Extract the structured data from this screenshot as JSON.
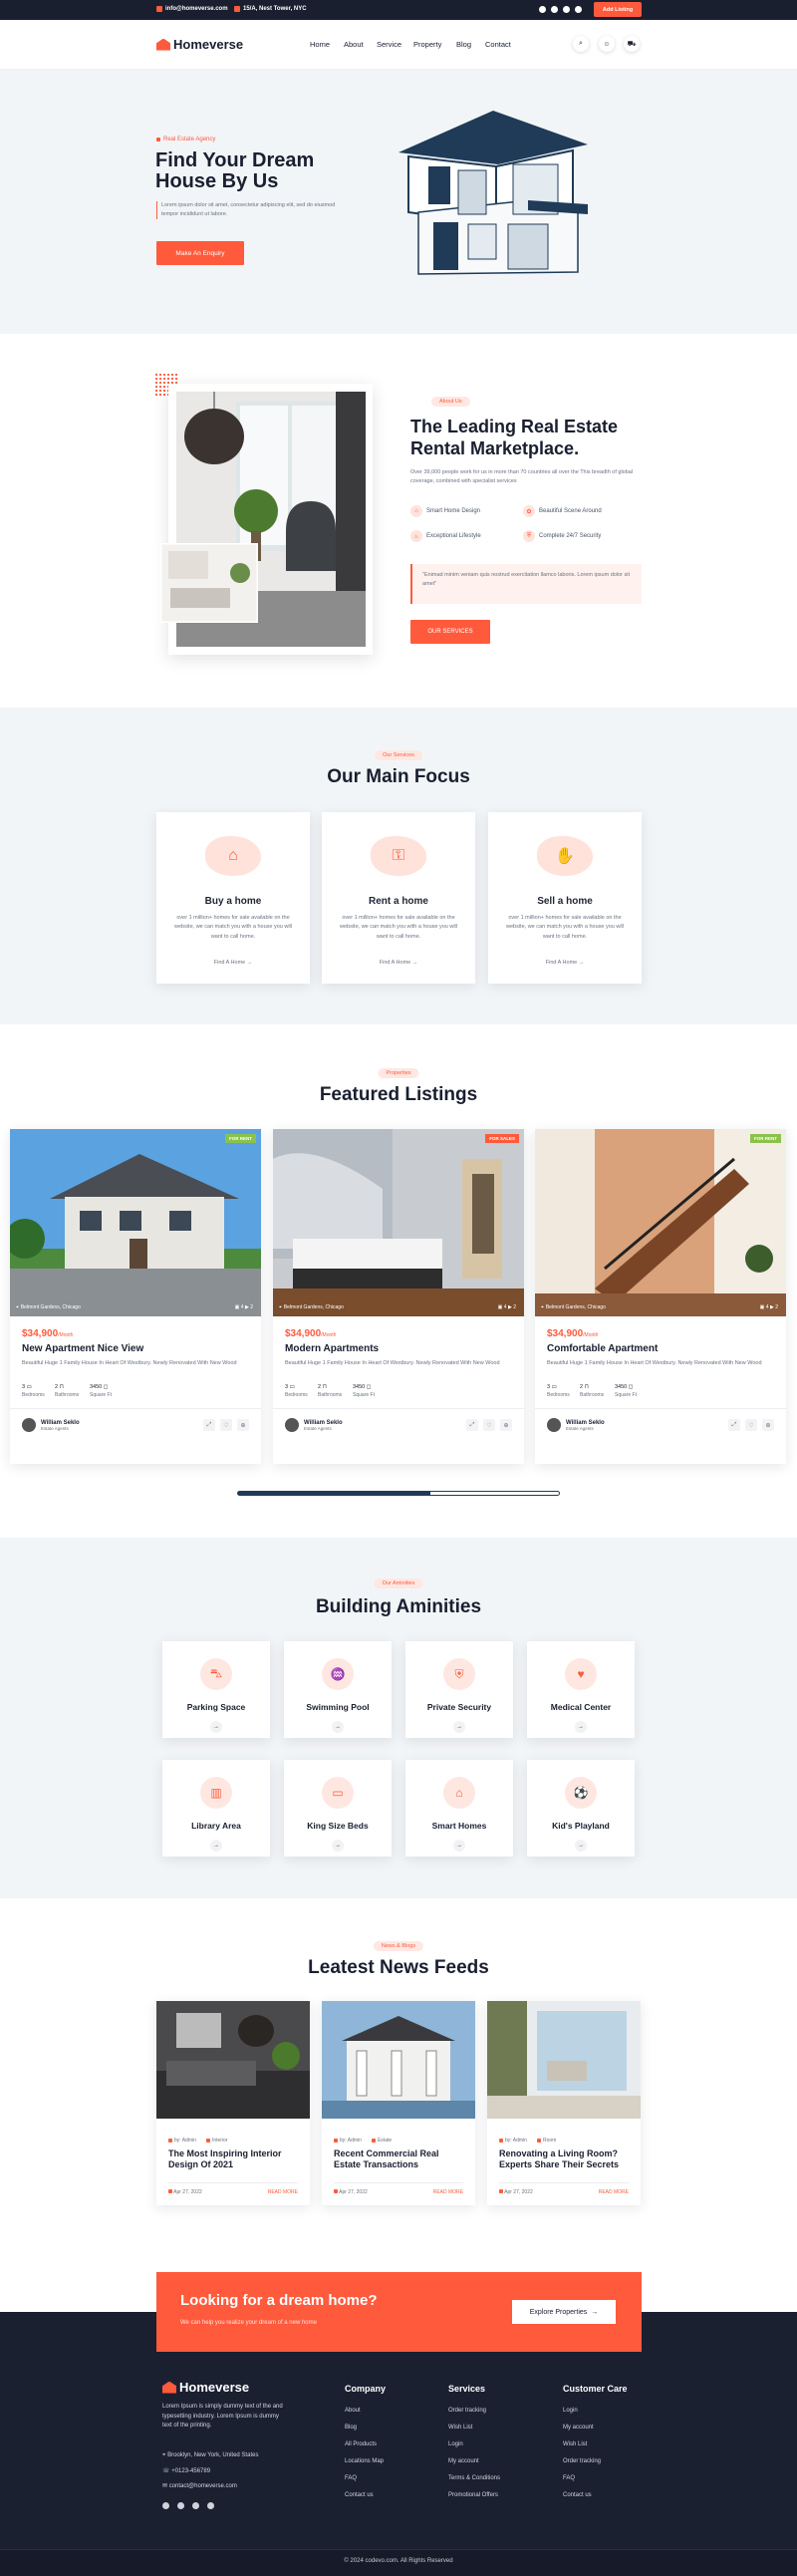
{
  "topbar": {
    "email": "info@homeverse.com",
    "address": "15/A, Nest Tower, NYC",
    "add_listing": "Add Listing"
  },
  "header": {
    "logo": "Homeverse",
    "nav": [
      "Home",
      "About",
      "Service",
      "Property",
      "Blog",
      "Contact"
    ]
  },
  "hero": {
    "kicker": "Real Estate Agency",
    "title": "Find Your Dream House By Us",
    "text": "Lorem ipsum dolor sit amet, consectetur adipiscing elit, sed do eiusmod tempor incididunt ut labore.",
    "cta": "Make An Enquiry"
  },
  "about": {
    "tag": "About Us",
    "title": "The Leading Real Estate Rental Marketplace.",
    "text": "Over 39,000 people work for us in more than 70 countries all over the This breadth of global coverage, combined with specialist services",
    "features": [
      "Smart Home Design",
      "Beautiful Scene Around",
      "Exceptional Lifestyle",
      "Complete 24/7 Security"
    ],
    "quote": "\"Enimad minim veniam quis nostrud exercitation llamco laboris. Lorem ipsum dolor sit amet\"",
    "button": "OUR SERVICES"
  },
  "service": {
    "tag": "Our Services",
    "title": "Our Main Focus",
    "cards": [
      {
        "title": "Buy a home",
        "text": "over 1 million+ homes for sale available on the website, we can match you with a house you will want to call home.",
        "link": "Find A Home"
      },
      {
        "title": "Rent a home",
        "text": "over 1 million+ homes for sale available on the website, we can match you with a house you will want to call home.",
        "link": "Find A Home"
      },
      {
        "title": "Sell a home",
        "text": "over 1 million+ homes for sale available on the website, we can match you with a house you will want to call home.",
        "link": "Find A Home"
      }
    ]
  },
  "property": {
    "tag": "Properties",
    "title": "Featured Listings",
    "listings": [
      {
        "badge": "FOR RENT",
        "badge_color": "#8bc34a",
        "location": "Belmont Gardens, Chicago",
        "photos": "4",
        "videos": "2",
        "price": "$34,900",
        "per": "/Month",
        "title": "New Apartment Nice View",
        "desc": "Beautiful Huge 1 Family House In Heart Of Westbury. Newly Renovated With New Wood",
        "beds": "3",
        "baths": "2",
        "area": "3450",
        "beds_label": "Bedrooms",
        "baths_label": "Bathrooms",
        "area_label": "Square Ft",
        "agent": "William Seklo",
        "role": "Estate Agents"
      },
      {
        "badge": "FOR SALES",
        "badge_color": "#ff5a3c",
        "location": "Belmont Gardens, Chicago",
        "photos": "4",
        "videos": "2",
        "price": "$34,900",
        "per": "/Month",
        "title": "Modern Apartments",
        "desc": "Beautiful Huge 1 Family House In Heart Of Westbury. Newly Renovated With New Wood",
        "beds": "3",
        "baths": "2",
        "area": "3450",
        "beds_label": "Bedrooms",
        "baths_label": "Bathrooms",
        "area_label": "Square Ft",
        "agent": "William Seklo",
        "role": "Estate Agents"
      },
      {
        "badge": "FOR RENT",
        "badge_color": "#8bc34a",
        "location": "Belmont Gardens, Chicago",
        "photos": "4",
        "videos": "2",
        "price": "$34,900",
        "per": "/Month",
        "title": "Comfortable Apartment",
        "desc": "Beautiful Huge 1 Family House In Heart Of Westbury. Newly Renovated With New Wood",
        "beds": "3",
        "baths": "2",
        "area": "3450",
        "beds_label": "Bedrooms",
        "baths_label": "Bathrooms",
        "area_label": "Square Ft",
        "agent": "William Seklo",
        "role": "Estate Agents"
      }
    ]
  },
  "features": {
    "tag": "Our Aminities",
    "title": "Building Aminities",
    "items": [
      "Parking Space",
      "Swimming Pool",
      "Private Security",
      "Medical Center",
      "Library Area",
      "King Size Beds",
      "Smart Homes",
      "Kid's Playland"
    ],
    "icons": [
      "car-icon",
      "pool-icon",
      "shield-icon",
      "heart-pulse-icon",
      "library-icon",
      "bed-icon",
      "home-icon",
      "ball-icon"
    ]
  },
  "blog": {
    "tag": "News & Blogs",
    "title": "Leatest News Feeds",
    "posts": [
      {
        "author": "by: Admin",
        "cat": "Interior",
        "title": "The Most Inspiring Interior Design Of 2021",
        "date": "Apr 27, 2022",
        "more": "READ MORE"
      },
      {
        "author": "by: Admin",
        "cat": "Estate",
        "title": "Recent Commercial Real Estate Transactions",
        "date": "Apr 27, 2022",
        "more": "READ MORE"
      },
      {
        "author": "by: Admin",
        "cat": "Room",
        "title": "Renovating a Living Room? Experts Share Their Secrets",
        "date": "Apr 27, 2022",
        "more": "READ MORE"
      }
    ]
  },
  "cta": {
    "title": "Looking for a dream home?",
    "text": "We can help you realize your dream of a new home",
    "button": "Explore Properties"
  },
  "footer": {
    "logo": "Homeverse",
    "text": "Lorem Ipsum is simply dummy text of the and typesetting industry. Lorem Ipsum is dummy text of the printing.",
    "address": "Brooklyn, New York, United States",
    "phone": "+0123-456789",
    "email": "contact@homeverse.com",
    "cols": [
      {
        "title": "Company",
        "links": [
          "About",
          "Blog",
          "All Products",
          "Locations Map",
          "FAQ",
          "Contact us"
        ]
      },
      {
        "title": "Services",
        "links": [
          "Order tracking",
          "Wish List",
          "Login",
          "My account",
          "Terms & Conditions",
          "Promotional Offers"
        ]
      },
      {
        "title": "Customer Care",
        "links": [
          "Login",
          "My account",
          "Wish List",
          "Order tracking",
          "FAQ",
          "Contact us"
        ]
      }
    ],
    "copyright": "© 2024 codevo.com. All Rights Reserved"
  },
  "colors": {
    "accent": "#ff5a3c",
    "dark": "#1a1f30",
    "bg_light": "#f2f5f7"
  }
}
